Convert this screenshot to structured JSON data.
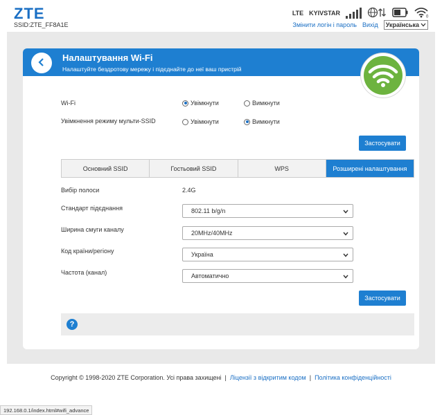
{
  "header": {
    "logo": "ZTE",
    "ssid": "SSID:ZTE_FF8A1E",
    "network_type": "LTE",
    "carrier": "KYIVSTAR",
    "change_login": "Змінити логін і пароль",
    "logout": "Вихід",
    "language": "Українська"
  },
  "page": {
    "title": "Налаштування Wi-Fi",
    "subtitle": "Налаштуйте бездротову мережу і підєднайте до неї ваш пристрій"
  },
  "settings": {
    "wifi_label": "Wi-Fi",
    "wifi_on": "Увімкнути",
    "wifi_off": "Вимкнути",
    "wifi_selected": "on",
    "multi_ssid_label": "Увімкнення режиму мульти-SSID",
    "multi_on": "Увімкнути",
    "multi_off": "Вимкнути",
    "multi_selected": "off",
    "apply": "Застосувати"
  },
  "tabs": [
    {
      "label": "Основний SSID",
      "active": false
    },
    {
      "label": "Гостьовий SSID",
      "active": false
    },
    {
      "label": "WPS",
      "active": false
    },
    {
      "label": "Розширені налаштування",
      "active": true
    }
  ],
  "advanced": {
    "band_label": "Вибір полоси",
    "band_value": "2.4G",
    "standard_label": "Стандарт підєднання",
    "standard_value": "802.11 b/g/n",
    "bandwidth_label": "Ширина смуги каналу",
    "bandwidth_value": "20MHz/40MHz",
    "region_label": "Код країни/регіону",
    "region_value": "Україна",
    "channel_label": "Частота (канал)",
    "channel_value": "Автоматично",
    "apply": "Застосувати"
  },
  "footer": {
    "copyright": "Copyright © 1998-2020 ZTE Corporation. Усі права захищені",
    "sep": "|",
    "license": "Ліцензії з відкритим кодом",
    "privacy": "Політика конфіденційності"
  },
  "statusbar": {
    "url": "192.168.0.1/index.html#wifi_advance"
  },
  "colors": {
    "accent": "#1e7fd1",
    "wifi_green": "#6db33f"
  }
}
